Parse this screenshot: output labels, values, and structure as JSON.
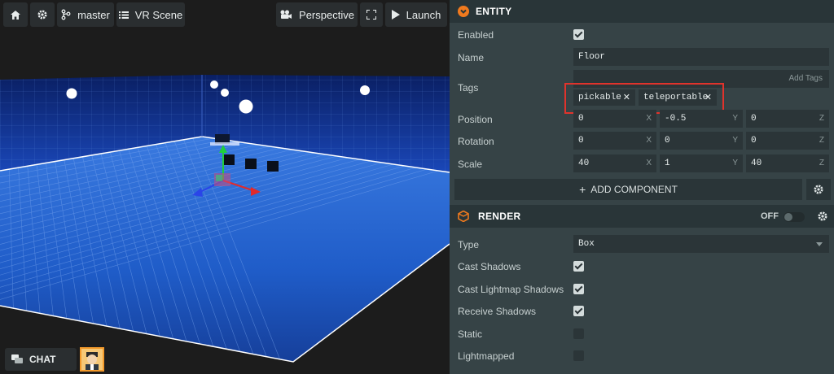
{
  "toolbar": {
    "home_icon": "home-icon",
    "settings_icon": "gear-icon",
    "branch_label": "master",
    "scene_label": "VR Scene",
    "camera_label": "Perspective",
    "launch_label": "Launch"
  },
  "viewport": {
    "chat_label": "CHAT",
    "sky_color": "#0f2f8c",
    "floor_color": "#1f5fd0"
  },
  "entity_panel": {
    "title": "ENTITY",
    "accent": "#f07a1e",
    "enabled_label": "Enabled",
    "enabled": true,
    "name_label": "Name",
    "name_value": "Floor",
    "tags_label": "Tags",
    "add_tags_placeholder": "Add Tags",
    "tags": [
      "pickable",
      "teleportable"
    ],
    "position_label": "Position",
    "position": [
      "0",
      "-0.5",
      "0"
    ],
    "rotation_label": "Rotation",
    "rotation": [
      "0",
      "0",
      "0"
    ],
    "scale_label": "Scale",
    "scale": [
      "40",
      "1",
      "40"
    ],
    "axes": [
      "X",
      "Y",
      "Z"
    ],
    "add_component_label": "ADD COMPONENT"
  },
  "render_panel": {
    "title": "RENDER",
    "toggle_label": "OFF",
    "type_label": "Type",
    "type_value": "Box",
    "cast_shadows_label": "Cast Shadows",
    "cast_shadows": true,
    "cast_lightmap_label": "Cast Lightmap Shadows",
    "cast_lightmap": true,
    "receive_shadows_label": "Receive Shadows",
    "receive_shadows": true,
    "static_label": "Static",
    "static": false,
    "lightmapped_label": "Lightmapped",
    "lightmapped": false
  }
}
